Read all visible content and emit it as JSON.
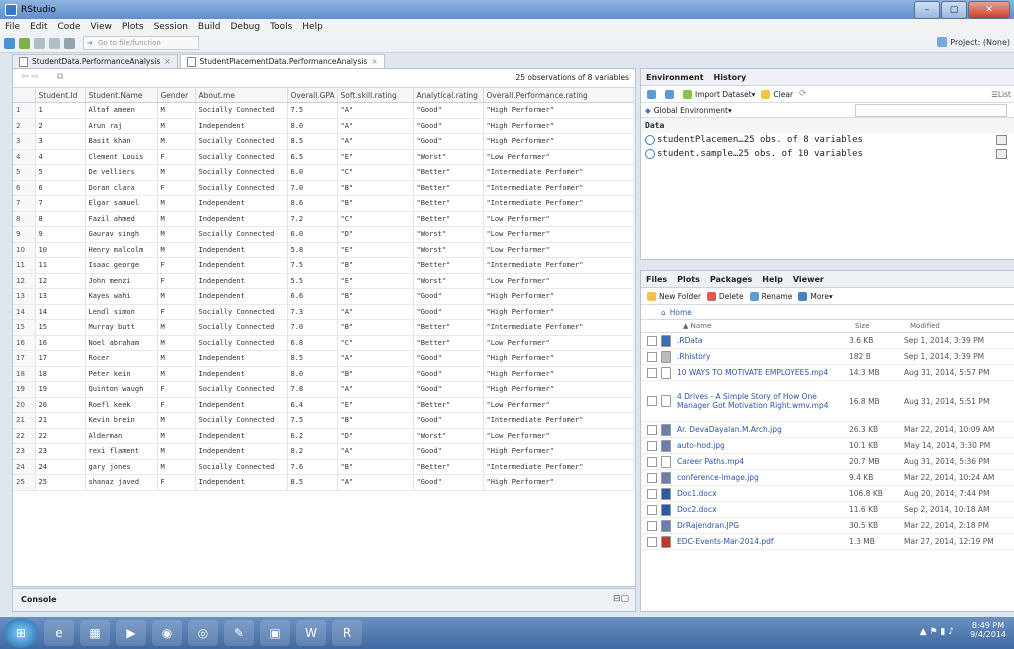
{
  "window": {
    "title": "RStudio",
    "min": "–",
    "max": "▢",
    "close": "✕"
  },
  "menu": [
    "File",
    "Edit",
    "Code",
    "View",
    "Plots",
    "Session",
    "Build",
    "Debug",
    "Tools",
    "Help"
  ],
  "toolbar": {
    "goto_placeholder": "Go to file/function",
    "project": "Project: (None)"
  },
  "editor_tabs": [
    {
      "label": "StudentData.PerformanceAnalysis"
    },
    {
      "label": "StudentPlacementData.PerformanceAnalysis"
    }
  ],
  "dataview": {
    "observations": "25 observations of 8 variables",
    "columns": [
      "",
      "Student.Id",
      "Student.Name",
      "Gender",
      "About.me",
      "Overall.GPA",
      "Soft.skill.rating",
      "Analytical.rating",
      "Overall.Performance.rating"
    ],
    "rows": [
      [
        "1",
        "1",
        "Altaf ameen",
        "M",
        "Socially Connected",
        "7.5",
        "\"A\"",
        "\"Good\"",
        "\"High Performer\""
      ],
      [
        "2",
        "2",
        "Arun raj",
        "M",
        "Independent",
        "8.0",
        "\"A\"",
        "\"Good\"",
        "\"High Performer\""
      ],
      [
        "3",
        "3",
        "Basit khan",
        "M",
        "Socially Connected",
        "8.5",
        "\"A\"",
        "\"Good\"",
        "\"High Performer\""
      ],
      [
        "4",
        "4",
        "Clement Louis",
        "F",
        "Socially Connected",
        "6.5",
        "\"E\"",
        "\"Worst\"",
        "\"Low Performer\""
      ],
      [
        "5",
        "5",
        "De velliers",
        "M",
        "Socially Connected",
        "6.0",
        "\"C\"",
        "\"Better\"",
        "\"Intermediate Perfomer\""
      ],
      [
        "6",
        "6",
        "Doran clara",
        "F",
        "Socially Connected",
        "7.0",
        "\"B\"",
        "\"Better\"",
        "\"Intermediate Perfomer\""
      ],
      [
        "7",
        "7",
        "Elgar samuel",
        "M",
        "Independent",
        "8.6",
        "\"B\"",
        "\"Better\"",
        "\"Intermediate Perfomer\""
      ],
      [
        "8",
        "8",
        "Fazil ahmed",
        "M",
        "Independent",
        "7.2",
        "\"C\"",
        "\"Better\"",
        "\"Low Performer\""
      ],
      [
        "9",
        "9",
        "Gaurav singh",
        "M",
        "Socially Connected",
        "6.0",
        "\"D\"",
        "\"Worst\"",
        "\"Low Performer\""
      ],
      [
        "10",
        "10",
        "Henry malcolm",
        "M",
        "Independent",
        "5.8",
        "\"E\"",
        "\"Worst\"",
        "\"Low Performer\""
      ],
      [
        "11",
        "11",
        "Isaac george",
        "F",
        "Independent",
        "7.5",
        "\"B\"",
        "\"Better\"",
        "\"Intermediate Perfomer\""
      ],
      [
        "12",
        "12",
        "John menzi",
        "F",
        "Independent",
        "5.5",
        "\"E\"",
        "\"Worst\"",
        "\"Low Performer\""
      ],
      [
        "13",
        "13",
        "Kayes wahi",
        "M",
        "Independent",
        "6.6",
        "\"B\"",
        "\"Good\"",
        "\"High Performer\""
      ],
      [
        "14",
        "14",
        "Lendl simon",
        "F",
        "Socially Connected",
        "7.3",
        "\"A\"",
        "\"Good\"",
        "\"High Performer\""
      ],
      [
        "15",
        "15",
        "Murray butt",
        "M",
        "Socially Connected",
        "7.0",
        "\"B\"",
        "\"Better\"",
        "\"Intermediate Perfomer\""
      ],
      [
        "16",
        "16",
        "Noel abraham",
        "M",
        "Socially Connected",
        "6.8",
        "\"C\"",
        "\"Better\"",
        "\"Low Performer\""
      ],
      [
        "17",
        "17",
        "Rocer",
        "M",
        "Independent",
        "8.5",
        "\"A\"",
        "\"Good\"",
        "\"High Performer\""
      ],
      [
        "18",
        "18",
        "Peter kein",
        "M",
        "Independent",
        "8.0",
        "\"B\"",
        "\"Good\"",
        "\"High Performer\""
      ],
      [
        "19",
        "19",
        "Quinton waugh",
        "F",
        "Socially Connected",
        "7.8",
        "\"A\"",
        "\"Good\"",
        "\"High Performer\""
      ],
      [
        "20",
        "20",
        "Roefl keek",
        "F",
        "Independent",
        "6.4",
        "\"E\"",
        "\"Better\"",
        "\"Low Performer\""
      ],
      [
        "21",
        "21",
        "Kevin brein",
        "M",
        "Socially Connected",
        "7.5",
        "\"B\"",
        "\"Good\"",
        "\"Intermediate Perfomer\""
      ],
      [
        "22",
        "22",
        "Alderman",
        "M",
        "Independent",
        "6.2",
        "\"D\"",
        "\"Worst\"",
        "\"Low Performer\""
      ],
      [
        "23",
        "23",
        "rexi flament",
        "M",
        "Independent",
        "8.2",
        "\"A\"",
        "\"Good\"",
        "\"High Performer\""
      ],
      [
        "24",
        "24",
        "gary jones",
        "M",
        "Socially Connected",
        "7.6",
        "\"B\"",
        "\"Better\"",
        "\"Intermediate Perfomer\""
      ],
      [
        "25",
        "25",
        "shanaz javed",
        "F",
        "Independent",
        "8.5",
        "\"A\"",
        "\"Good\"",
        "\"High Performer\""
      ]
    ]
  },
  "console": {
    "label": "Console"
  },
  "env": {
    "tabs": [
      "Environment",
      "History"
    ],
    "import": "Import Dataset",
    "clear": "Clear",
    "list": "List",
    "scope": "Global Environment",
    "data_header": "Data",
    "objects": [
      {
        "text": "studentPlacemen…25 obs. of 8 variables"
      },
      {
        "text": "student.sample…25 obs. of 10 variables"
      }
    ]
  },
  "files": {
    "tabs": [
      "Files",
      "Plots",
      "Packages",
      "Help",
      "Viewer"
    ],
    "new_folder": "New Folder",
    "delete": "Delete",
    "rename": "Rename",
    "more": "More",
    "home": "Home",
    "headers": {
      "name": "▲ Name",
      "size": "Size",
      "modified": "Modified"
    },
    "items": [
      {
        "name": ".RData",
        "size": "3.6 KB",
        "modified": "Sep 1, 2014, 3:39 PM",
        "color": "#3a6fb0"
      },
      {
        "name": ".Rhistory",
        "size": "182 B",
        "modified": "Sep 1, 2014, 3:39 PM",
        "color": "#bbbbbb"
      },
      {
        "name": "10 WAYS TO MOTIVATE EMPLOYEES.mp4",
        "size": "14.3 MB",
        "modified": "Aug 31, 2014, 5:57 PM",
        "color": "#ffffff"
      },
      {
        "name": "4 Drives - A Simple Story of How One Manager Got Motivation Right.wmv.mp4",
        "size": "16.8 MB",
        "modified": "Aug 31, 2014, 5:51 PM",
        "color": "#ffffff"
      },
      {
        "name": "Ar. DevaDayalan.M.Arch.jpg",
        "size": "26.3 KB",
        "modified": "Mar 22, 2014, 10:09 AM",
        "color": "#6a7fb0"
      },
      {
        "name": "auto-hod.jpg",
        "size": "10.1 KB",
        "modified": "May 14, 2014, 3:30 PM",
        "color": "#6a7fb0"
      },
      {
        "name": "Career Paths.mp4",
        "size": "20.7 MB",
        "modified": "Aug 31, 2014, 5:36 PM",
        "color": "#ffffff"
      },
      {
        "name": "conference-image.jpg",
        "size": "9.4 KB",
        "modified": "Mar 22, 2014, 10:24 AM",
        "color": "#6a7fb0"
      },
      {
        "name": "Doc1.docx",
        "size": "106.8 KB",
        "modified": "Aug 20, 2014, 7:44 PM",
        "color": "#2c5aa8"
      },
      {
        "name": "Doc2.docx",
        "size": "11.6 KB",
        "modified": "Sep 2, 2014, 10:18 AM",
        "color": "#2c5aa8"
      },
      {
        "name": "DrRajendran.JPG",
        "size": "30.5 KB",
        "modified": "Mar 22, 2014, 2:18 PM",
        "color": "#6a7fb0"
      },
      {
        "name": "EDC-Events-Mar-2014.pdf",
        "size": "1.3 MB",
        "modified": "Mar 27, 2014, 12:19 PM",
        "color": "#c0392b"
      }
    ]
  },
  "taskbar": {
    "apps": [
      {
        "icon": "folder-icon",
        "glyph": "▦"
      },
      {
        "icon": "media-player-icon",
        "glyph": "▶"
      },
      {
        "icon": "firefox-icon",
        "glyph": "◉"
      },
      {
        "icon": "chrome-icon",
        "glyph": "◎"
      },
      {
        "icon": "app-icon",
        "glyph": "✎"
      },
      {
        "icon": "powerpoint-icon",
        "glyph": "▣"
      },
      {
        "icon": "word-icon",
        "glyph": "W"
      },
      {
        "icon": "rstudio-icon",
        "glyph": "R"
      }
    ],
    "time": "8:49 PM",
    "date": "9/4/2014"
  }
}
